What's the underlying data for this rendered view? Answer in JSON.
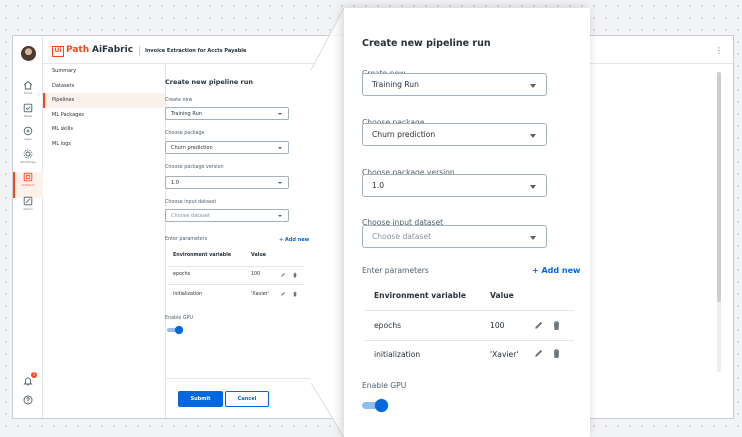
{
  "brand": {
    "logo_mark": "Ui",
    "logo_rest": "Path",
    "product": "AiFabric",
    "accent": "#fa4616"
  },
  "header": {
    "breadcrumb": "Invoice Extraction for Accts Payable",
    "more_icon": "more-vert-icon"
  },
  "rail": {
    "items": [
      {
        "label": "Home",
        "icon": "home-icon"
      },
      {
        "label": "Tasks",
        "icon": "tasks-icon"
      },
      {
        "label": "Apps",
        "icon": "apps-icon"
      },
      {
        "label": "Workflows",
        "icon": "workflows-icon"
      },
      {
        "label": "AI Fabric",
        "icon": "ai-fabric-icon",
        "active": true
      },
      {
        "label": "Admin",
        "icon": "admin-icon"
      }
    ],
    "notification_count": "1"
  },
  "nav": {
    "items": [
      {
        "label": "Summary"
      },
      {
        "label": "Datasets"
      },
      {
        "label": "Pipelines",
        "active": true
      },
      {
        "label": "ML Packages"
      },
      {
        "label": "ML skills"
      },
      {
        "label": "ML logs"
      }
    ]
  },
  "form": {
    "title": "Create new pipeline run",
    "create_new": {
      "label": "Create new",
      "value": "Training Run"
    },
    "package": {
      "label": "Choose package",
      "value": "Churn prediction"
    },
    "package_version": {
      "label": "Choose package version",
      "value": "1.0"
    },
    "input_dataset": {
      "label": "Choose input dataset",
      "placeholder": "Choose dataset"
    },
    "parameters": {
      "label": "Enter parameters",
      "add_label": "+ Add new",
      "columns": [
        "Environment variable",
        "Value"
      ],
      "rows": [
        {
          "name": "epochs",
          "value": "100"
        },
        {
          "name": "initialization",
          "value": "'Xavier'"
        }
      ]
    },
    "gpu": {
      "label": "Enable GPU",
      "enabled": true
    },
    "submit_label": "Submit",
    "cancel_label": "Cancel"
  },
  "colors": {
    "primary": "#0067df",
    "accent": "#fa4616",
    "toggle_track": "#8fbef5"
  }
}
